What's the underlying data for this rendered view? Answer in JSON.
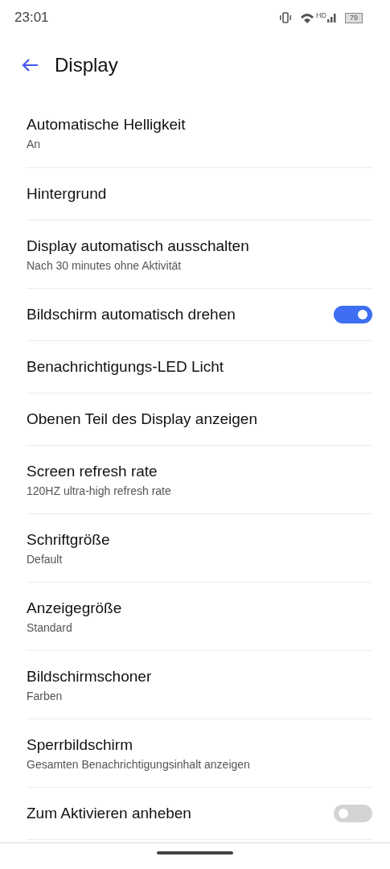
{
  "status_bar": {
    "time": "23:01",
    "network": "HD",
    "battery": "79"
  },
  "header": {
    "title": "Display"
  },
  "items": [
    {
      "kind": "plain",
      "title": "Automatische Helligkeit",
      "subtitle": "An"
    },
    {
      "kind": "plain",
      "title": "Hintergrund"
    },
    {
      "kind": "plain",
      "title": "Display automatisch ausschalten",
      "subtitle": "Nach 30 minutes ohne Aktivität"
    },
    {
      "kind": "switch",
      "title": "Bildschirm automatisch drehen",
      "on": true
    },
    {
      "kind": "plain",
      "title": "Benachrichtigungs-LED Licht"
    },
    {
      "kind": "plain",
      "title": "Obenen Teil des Display anzeigen"
    },
    {
      "kind": "plain",
      "title": "Screen refresh rate",
      "subtitle": "120HZ ultra-high refresh rate"
    },
    {
      "kind": "plain",
      "title": "Schriftgröße",
      "subtitle": "Default"
    },
    {
      "kind": "plain",
      "title": "Anzeigegröße",
      "subtitle": "Standard"
    },
    {
      "kind": "plain",
      "title": "Bildschirmschoner",
      "subtitle": "Farben"
    },
    {
      "kind": "plain",
      "title": "Sperrbildschirm",
      "subtitle": "Gesamten Benachrichtigungsinhalt anzeigen"
    },
    {
      "kind": "switch",
      "title": "Zum Aktivieren anheben",
      "on": false
    }
  ]
}
